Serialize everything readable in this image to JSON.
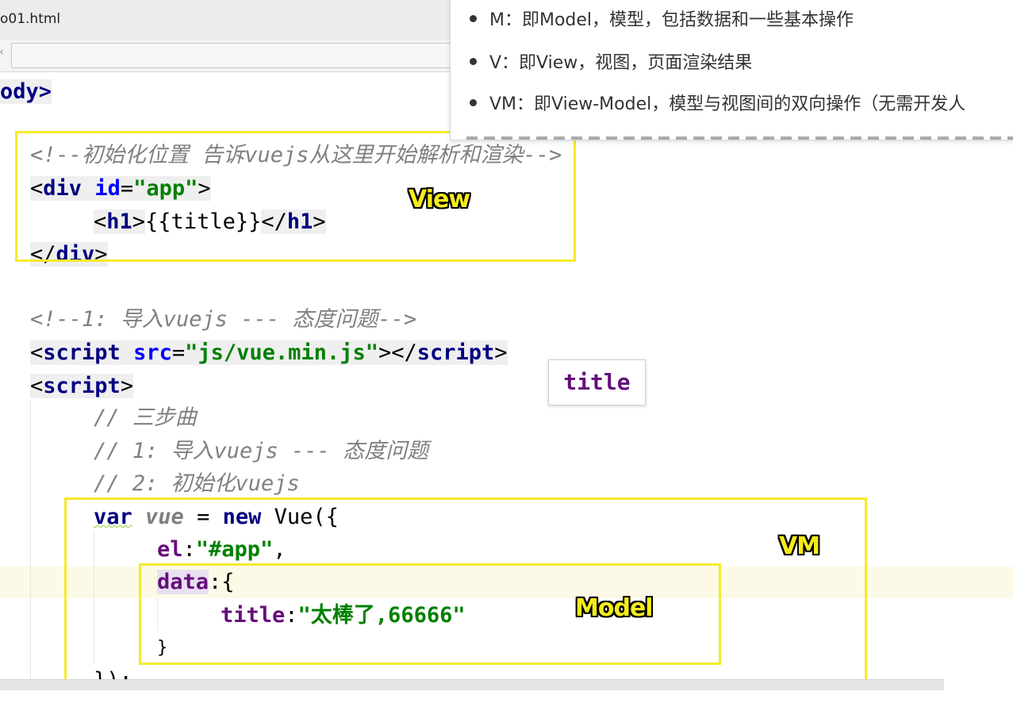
{
  "tab": {
    "filename": "o01.html"
  },
  "editor": {
    "body_tag": "ody>",
    "comment_init": "<!--初始化位置 告诉vuejs从这里开始解析和渲染-->",
    "div_open": {
      "tag": "div",
      "attr": "id",
      "value": "\"app\""
    },
    "h1_tag": "h1",
    "h1_content": "{{title}}",
    "div_close_tag": "div",
    "comment_import": "<!--1: 导入vuejs --- 态度问题-->",
    "script_src": {
      "tag": "script",
      "attr": "src",
      "value": "\"js/vue.min.js\""
    },
    "script_open": "script",
    "comments": [
      "// 三步曲",
      "// 1: 导入vuejs --- 态度问题",
      "// 2: 初始化vuejs"
    ],
    "var_kw": "var",
    "var_name": "vue",
    "new_kw": "new",
    "vue_ctor": "Vue({",
    "el_key": "el",
    "el_value": "\"#app\"",
    "data_key": "data",
    "title_key": "title",
    "title_value": "\"太棒了,66666\"",
    "close_brace": "}",
    "close_all": "});"
  },
  "tooltip": {
    "text": "title"
  },
  "popup": {
    "items": [
      "M：即Model，模型，包括数据和一些基本操作",
      "V：即View，视图，页面渲染结果",
      "VM：即View-Model，模型与视图间的双向操作（无需开发人"
    ]
  },
  "annotations": {
    "view": "View",
    "vm": "VM",
    "model": "Model"
  },
  "colors": {
    "highlight": "#f5ea2a",
    "tag": "#000080",
    "attribute": "#0000ff",
    "string": "#008000",
    "comment": "#808080",
    "property": "#660e7a"
  }
}
